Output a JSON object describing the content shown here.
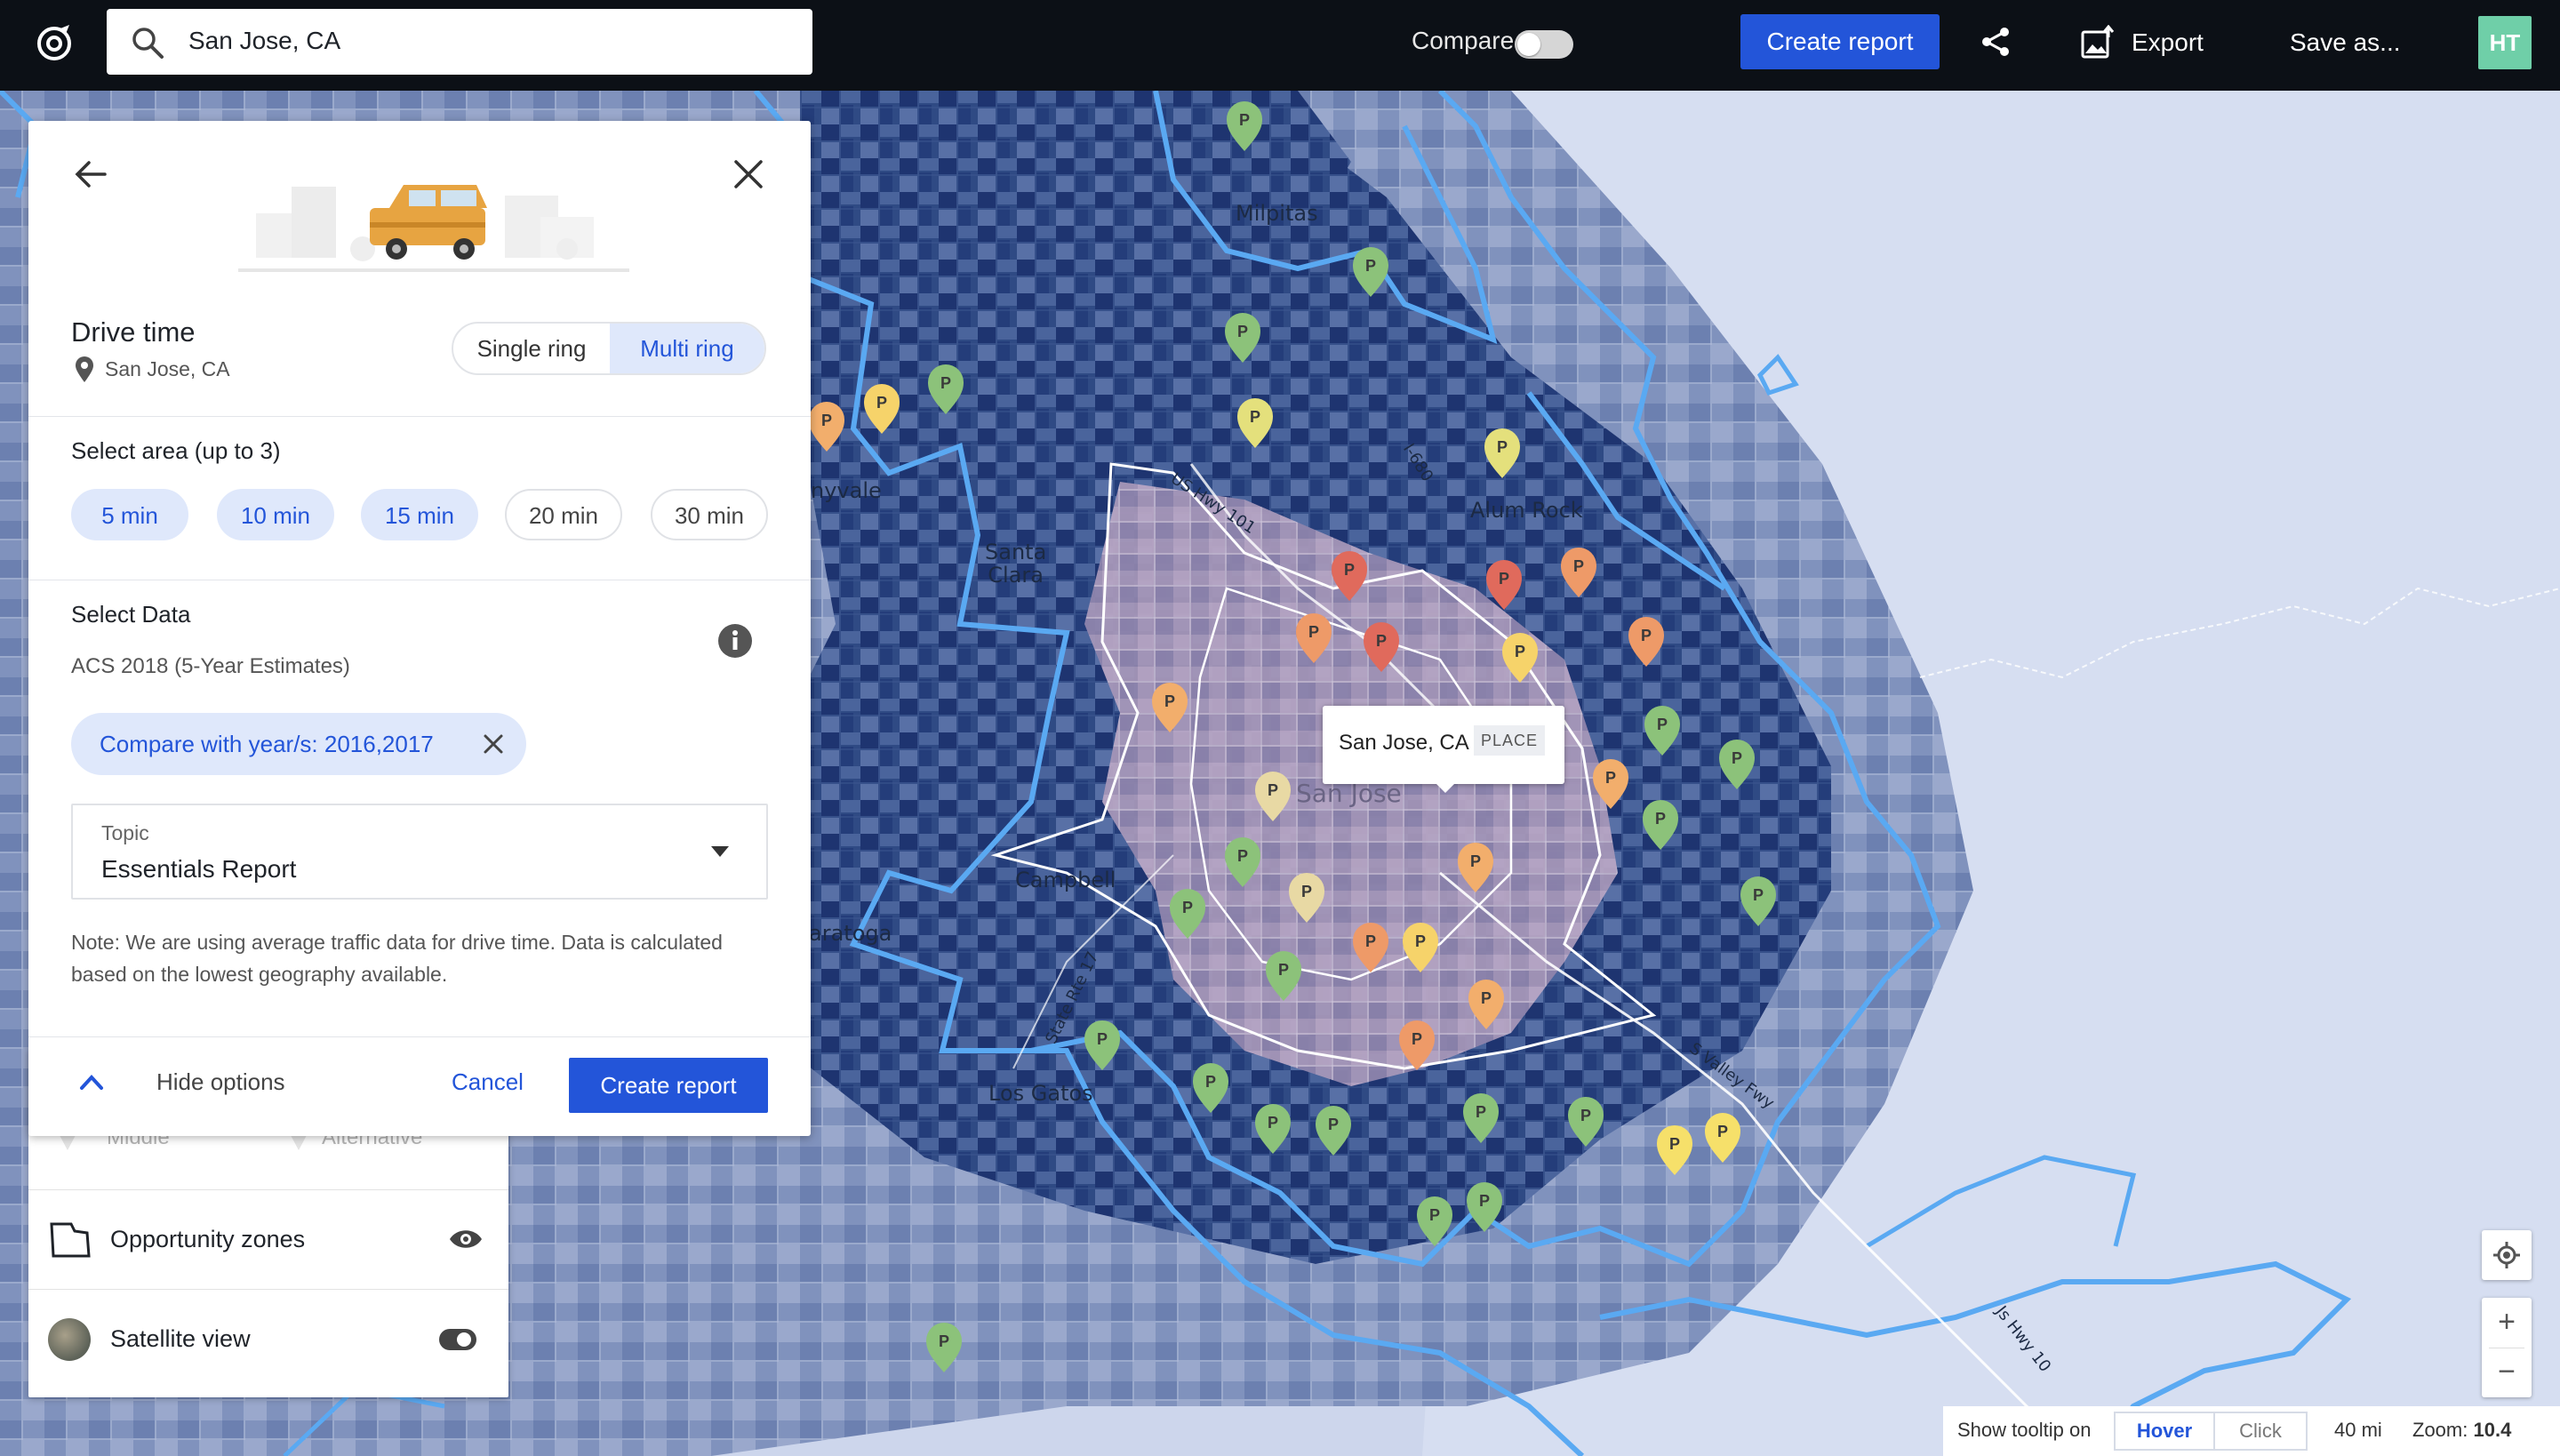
{
  "topbar": {
    "search_value": "San Jose, CA",
    "compare_label": "Compare",
    "compare_on": false,
    "create_report": "Create report",
    "export": "Export",
    "save_as": "Save as...",
    "avatar": "HT"
  },
  "panel": {
    "title": "Drive time",
    "location": "San Jose, CA",
    "ring_modes": [
      "Single ring",
      "Multi ring"
    ],
    "ring_selected": "Multi ring",
    "select_area_label": "Select area (up to 3)",
    "areas": [
      {
        "label": "5 min",
        "selected": true
      },
      {
        "label": "10 min",
        "selected": true
      },
      {
        "label": "15 min",
        "selected": true
      },
      {
        "label": "20 min",
        "selected": false
      },
      {
        "label": "30 min",
        "selected": false
      }
    ],
    "select_data_label": "Select Data",
    "dataset": "ACS 2018 (5-Year Estimates)",
    "compare_chip": "Compare with year/s: 2016,2017",
    "topic_caption": "Topic",
    "topic_value": "Essentials Report",
    "note": "Note: We are using average traffic data for drive time. Data is calculated based on the lowest geography available.",
    "hide_options": "Hide options",
    "cancel": "Cancel",
    "create_report": "Create report"
  },
  "layers": {
    "faded_left": "Middle",
    "faded_right": "Alternative",
    "rows": [
      {
        "label": "Opportunity zones",
        "icon": "polygon-icon",
        "control": "eye-icon"
      },
      {
        "label": "Satellite view",
        "icon": "satellite-thumb",
        "control": "toggle"
      }
    ]
  },
  "map": {
    "tooltip_name": "San Jose, CA",
    "tooltip_tag": "PLACE",
    "labels": [
      "Milpitas",
      "Santa\nClara",
      "nyvale",
      "Campbell",
      "aratoga",
      "Los Gatos",
      "Alum Rock",
      "San Jose",
      "US Hwy 101",
      "I-680",
      "State Rte 17",
      "S Valley Fwy",
      "Js Hwy 10"
    ],
    "show_tooltip_on": "Show tooltip on",
    "hover": "Hover",
    "click": "Click",
    "scale": "40 mi",
    "zoom_label": "Zoom:",
    "zoom_value": "10.4"
  },
  "colors": {
    "accent": "#2355d9",
    "topbar": "#0c1016",
    "chip_bg": "#dfe8fb",
    "boundary": "#5aa9f2"
  }
}
